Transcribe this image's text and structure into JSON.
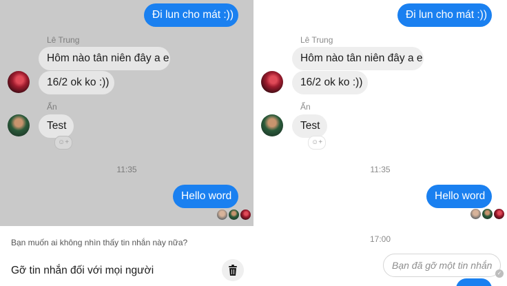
{
  "colors": {
    "outgoing_bubble": "#1a80f0",
    "incoming_bubble": "#eeeeee",
    "dim_overlay": "#c9c9c9",
    "meta_text": "#8a8a8a"
  },
  "messages": {
    "outgoing_top": "Đi lun cho mát :))",
    "sender_trung": "Lê Trung",
    "trung_msg_1": "Hôm nào tân niên đây a e",
    "trung_msg_2": "16/2 ok ko :))",
    "sender_an": "Ẩn",
    "an_msg": "Test",
    "time_1": "11:35",
    "outgoing_hello": "Hello word",
    "time_2": "17:00",
    "removed_msg": "Bạn đã gỡ một tin nhắn"
  },
  "sheet": {
    "question": "Bạn muốn ai không nhìn thấy tin nhắn này nữa?",
    "option_label": "Gỡ tin nhắn đối với mọi người"
  },
  "icons": {
    "react": "+",
    "trash": "trash-icon",
    "check": "✓"
  }
}
